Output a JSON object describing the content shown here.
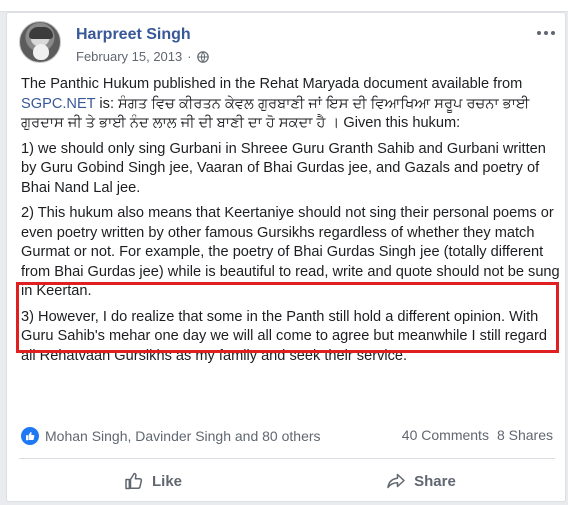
{
  "post": {
    "author": "Harpreet Singh",
    "date": "February 15, 2013",
    "privacy_icon": "globe-icon",
    "paragraphs": {
      "p1_prefix": "The Panthic Hukum published in the Rehat Maryada document available from ",
      "p1_link": "SGPC.NET",
      "p1_suffix": " is: ਸੰਗਤ ਵਿਚ ਕੀਰਤਨ ਕੇਵਲ ਗੁਰਬਾਣੀ ਜਾਂ ਇਸ ਦੀ ਵਿਆਖਿਆ ਸਰੂਪ ਰਚਨਾ ਭਾਈ ਗੁਰਦਾਸ ਜੀ ਤੇ ਭਾਈ ਨੰਦ ਲਾਲ ਜੀ ਦੀ ਬਾਣੀ ਦਾ ਹੋ ਸਕਦਾ ਹੈ । Given this hukum:",
      "p2": "1) we should only sing Gurbani in Shreee Guru Granth Sahib and Gurbani written by Guru Gobind Singh jee, Vaaran of Bhai Gurdas jee, and Gazals and poetry of Bhai Nand Lal jee.",
      "p3": "2) This hukum also means that Keertaniye should not sing their personal poems or even poetry written by other famous Gursikhs regardless of whether they match Gurmat or not. For example, the poetry of Bhai Gurdas Singh jee (totally different from Bhai Gurdas jee) while is beautiful to read, write and quote should not be sung in Keertan.",
      "p4": "3) However, I do realize that some in the Panth still hold a different opinion. With Guru Sahib's mehar one day we will all come to agree but meanwhile I still regard all Rehatvaan Gursikhs as my family and seek their service."
    }
  },
  "reactions": {
    "summary": "Mohan Singh, Davinder Singh and 80 others",
    "comments": "40 Comments",
    "shares": "8 Shares"
  },
  "actions": {
    "like_label": "Like",
    "share_label": "Share"
  },
  "colors": {
    "link": "#385898",
    "like_badge": "#2078f4",
    "highlight_border": "#e02020"
  }
}
